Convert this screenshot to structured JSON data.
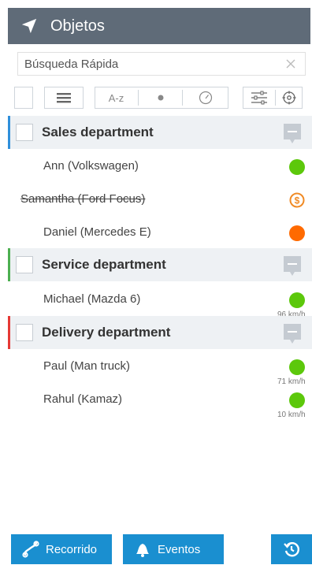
{
  "header": {
    "title": "Objetos"
  },
  "search": {
    "placeholder": "Búsqueda Rápida"
  },
  "toolbar": {
    "sort_label": "A-z"
  },
  "groups": [
    {
      "name": "Sales department",
      "accent": "#2f8fdb",
      "items": [
        {
          "name": "Ann (Volkswagen)",
          "status": "green"
        },
        {
          "name": "Samantha (Ford Focus)",
          "status": "coin",
          "strikethrough": true
        },
        {
          "name": "Daniel (Mercedes E)",
          "status": "orange"
        }
      ]
    },
    {
      "name": "Service department",
      "accent": "#4caf50",
      "items": [
        {
          "name": "Michael (Mazda 6)",
          "status": "green",
          "speed": "96 km/h"
        }
      ]
    },
    {
      "name": "Delivery department",
      "accent": "#e53935",
      "items": [
        {
          "name": "Paul (Man truck)",
          "status": "green",
          "speed": "71 km/h"
        },
        {
          "name": "Rahul (Kamaz)",
          "status": "green",
          "speed": "10 km/h"
        }
      ]
    }
  ],
  "bottom": {
    "track_label": "Recorrido",
    "events_label": "Eventos"
  },
  "colors": {
    "green": "#5cc80b",
    "orange": "#ff6a00",
    "coin": "#f08a24",
    "button": "#1a8fd0"
  }
}
